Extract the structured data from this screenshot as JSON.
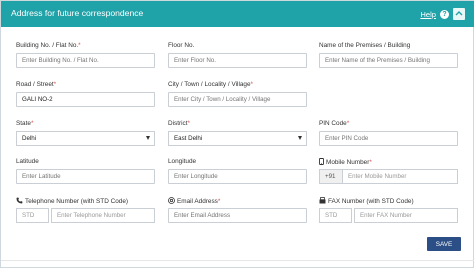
{
  "header": {
    "title": "Address for future correspondence",
    "help_label": "Help",
    "help_icon": "question-circle-icon",
    "toggle_icon": "collapse-toggle-icon",
    "color": "#1fa2a8"
  },
  "fields": {
    "building": {
      "label": "Building No. / Flat No.",
      "required": "*",
      "placeholder": "Enter Building No. / Flat No."
    },
    "floor": {
      "label": "Floor No.",
      "placeholder": "Enter Floor No."
    },
    "premises": {
      "label": "Name of the Premises / Building",
      "placeholder": "Enter Name of the Premises / Building"
    },
    "road": {
      "label": "Road / Street",
      "required": "*",
      "value": "GALI NO-2"
    },
    "city": {
      "label": "City / Town / Locality / Village",
      "required": "*",
      "placeholder": "Enter City / Town / Locality / Village"
    },
    "state": {
      "label": "State",
      "required": "*",
      "selected": "Delhi"
    },
    "district": {
      "label": "District",
      "required": "*",
      "selected": "East Delhi"
    },
    "pin": {
      "label": "PIN Code",
      "required": "*",
      "placeholder": "Enter PIN Code"
    },
    "latitude": {
      "label": "Latitude",
      "placeholder": "Enter Latitude"
    },
    "longitude": {
      "label": "Longitude",
      "placeholder": "Enter Longitude"
    },
    "mobile": {
      "label": "Mobile Number",
      "required": "*",
      "prefix": "+91",
      "placeholder": "Enter Mobile Number",
      "icon": "mobile-phone-icon"
    },
    "telephone": {
      "label": "Telephone Number (with STD Code)",
      "std_placeholder": "STD",
      "placeholder": "Enter Telephone Number",
      "icon": "telephone-icon"
    },
    "email": {
      "label": "Email Address",
      "required": "*",
      "placeholder": "Enter Email Address",
      "icon": "envelope-icon"
    },
    "fax": {
      "label": "FAX Number (with STD Code)",
      "std_placeholder": "STD",
      "placeholder": "Enter FAX Number",
      "icon": "fax-icon"
    }
  },
  "actions": {
    "save_label": "SAVE",
    "save_color": "#2c4e86"
  }
}
